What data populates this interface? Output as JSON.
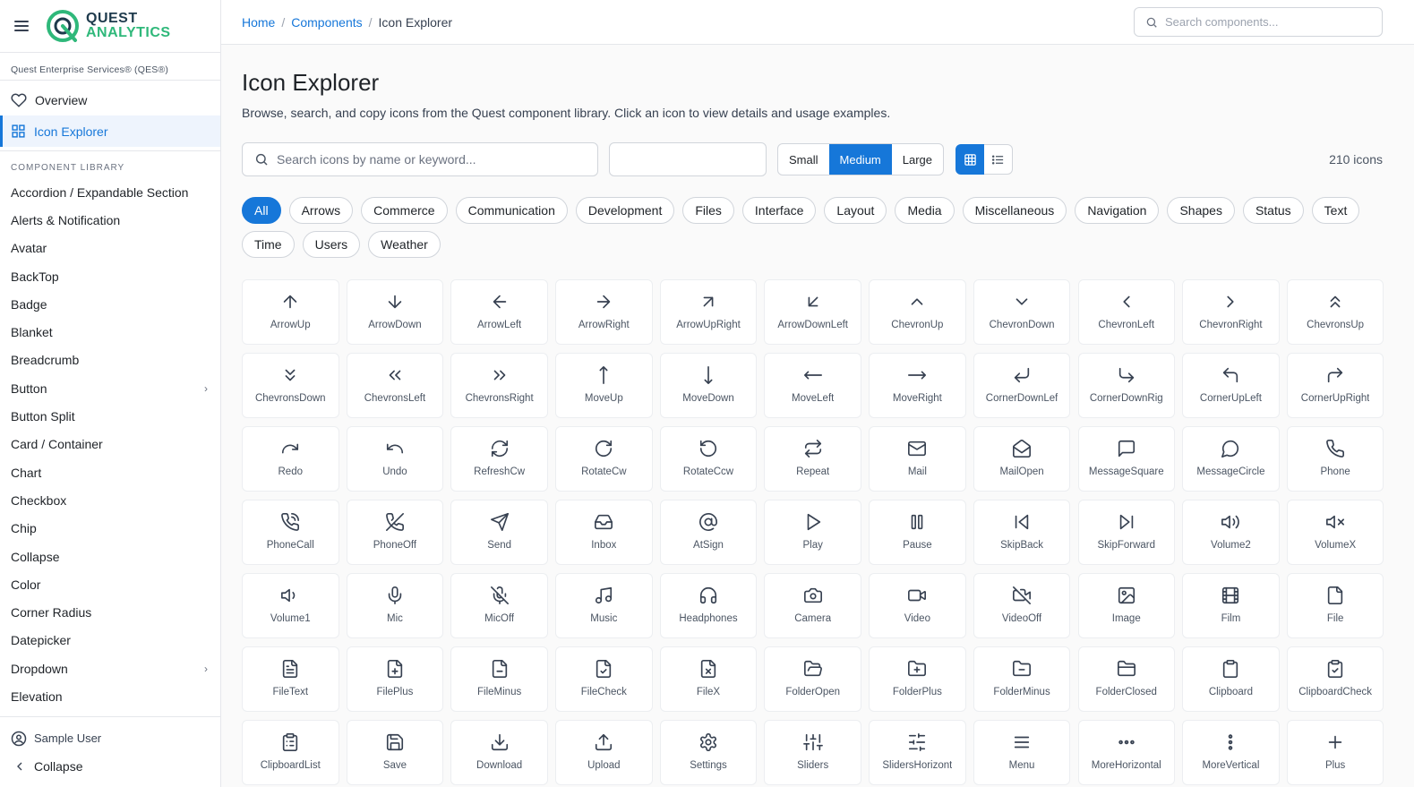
{
  "brand": {
    "line1": "QUEST",
    "line2": "ANALYTICS"
  },
  "org": "Quest Enterprise Services® (QES®)",
  "nav": [
    {
      "label": "Overview",
      "icon": "heart-icon"
    },
    {
      "label": "Icon Explorer",
      "icon": "grid-icon",
      "active": true
    }
  ],
  "library_label": "COMPONENT LIBRARY",
  "library": [
    {
      "label": "Accordion / Expandable Section"
    },
    {
      "label": "Alerts & Notification"
    },
    {
      "label": "Avatar"
    },
    {
      "label": "BackTop"
    },
    {
      "label": "Badge"
    },
    {
      "label": "Blanket"
    },
    {
      "label": "Breadcrumb"
    },
    {
      "label": "Button",
      "expandable": true
    },
    {
      "label": "Button Split"
    },
    {
      "label": "Card / Container"
    },
    {
      "label": "Chart"
    },
    {
      "label": "Checkbox"
    },
    {
      "label": "Chip"
    },
    {
      "label": "Collapse"
    },
    {
      "label": "Color"
    },
    {
      "label": "Corner Radius"
    },
    {
      "label": "Datepicker"
    },
    {
      "label": "Dropdown",
      "expandable": true
    },
    {
      "label": "Elevation"
    }
  ],
  "footer": {
    "user": "Sample User",
    "collapse": "Collapse"
  },
  "breadcrumb": {
    "home": "Home",
    "components": "Components",
    "current": "Icon Explorer"
  },
  "top_search": {
    "placeholder": "Search components..."
  },
  "page": {
    "title": "Icon Explorer",
    "subtitle": "Browse, search, and copy icons from the Quest component library. Click an icon to view details and usage examples."
  },
  "toolbar": {
    "search_placeholder": "Search icons by name or keyword...",
    "sizes": [
      "Small",
      "Medium",
      "Large"
    ],
    "selected_size": "Medium",
    "count": "210 icons"
  },
  "categories": [
    "All",
    "Arrows",
    "Commerce",
    "Communication",
    "Development",
    "Files",
    "Interface",
    "Layout",
    "Media",
    "Miscellaneous",
    "Navigation",
    "Shapes",
    "Status",
    "Text",
    "Time",
    "Users",
    "Weather"
  ],
  "selected_category": "All",
  "icons": [
    "ArrowUp",
    "ArrowDown",
    "ArrowLeft",
    "ArrowRight",
    "ArrowUpRight",
    "ArrowDownLeft",
    "ChevronUp",
    "ChevronDown",
    "ChevronLeft",
    "ChevronRight",
    "ChevronsUp",
    "ChevronsDown",
    "ChevronsLeft",
    "ChevronsRight",
    "MoveUp",
    "MoveDown",
    "MoveLeft",
    "MoveRight",
    "CornerDownLef",
    "CornerDownRig",
    "CornerUpLeft",
    "CornerUpRight",
    "Redo",
    "Undo",
    "RefreshCw",
    "RotateCw",
    "RotateCcw",
    "Repeat",
    "Mail",
    "MailOpen",
    "MessageSquare",
    "MessageCircle",
    "Phone",
    "PhoneCall",
    "PhoneOff",
    "Send",
    "Inbox",
    "AtSign",
    "Play",
    "Pause",
    "SkipBack",
    "SkipForward",
    "Volume2",
    "VolumeX",
    "Volume1",
    "Mic",
    "MicOff",
    "Music",
    "Headphones",
    "Camera",
    "Video",
    "VideoOff",
    "Image",
    "Film",
    "File",
    "FileText",
    "FilePlus",
    "FileMinus",
    "FileCheck",
    "FileX",
    "FolderOpen",
    "FolderPlus",
    "FolderMinus",
    "FolderClosed",
    "Clipboard",
    "ClipboardCheck",
    "ClipboardList",
    "Save",
    "Download",
    "Upload",
    "Settings",
    "Sliders",
    "SlidersHorizont",
    "Menu",
    "MoreHorizontal",
    "MoreVertical",
    "Plus"
  ],
  "colors": {
    "accent": "#1677d9",
    "brand_green": "#2fb87a",
    "brand_dark": "#1e3a4c"
  }
}
